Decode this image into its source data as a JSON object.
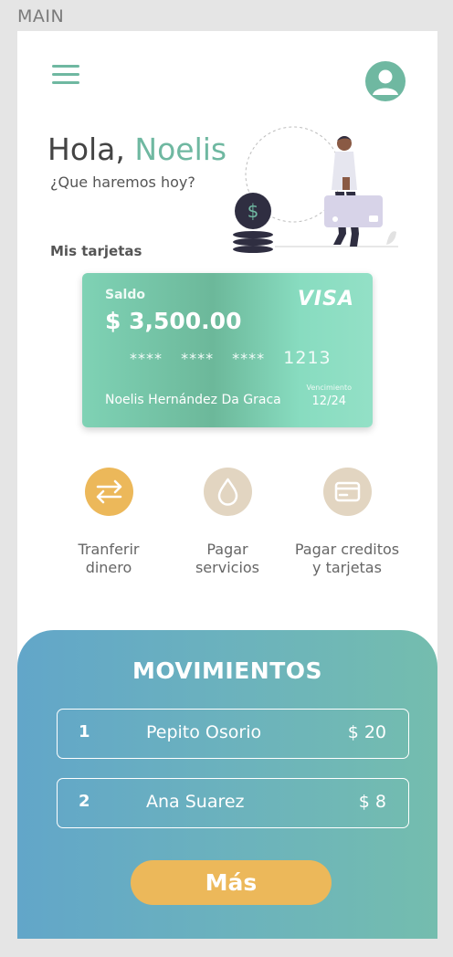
{
  "frame_label": "MAIN",
  "header": {
    "greeting": "Hola,",
    "user_name": "Noelis",
    "subtitle": "¿Que haremos hoy?"
  },
  "cards_section": {
    "title": "Mis tarjetas"
  },
  "card": {
    "balance_label": "Saldo",
    "balance": "$ 3,500.00",
    "brand": "VISA",
    "masked_groups": "**** **** ****",
    "last_digits": "1213",
    "holder": "Noelis Hernández Da Graca",
    "expiry_label": "Vencimiento",
    "expiry": "12/24"
  },
  "actions": [
    {
      "label_line1": "Tranferir",
      "label_line2": "dinero",
      "icon": "transfer-arrows-icon"
    },
    {
      "label_line1": "Pagar",
      "label_line2": "servicios",
      "icon": "water-drop-icon"
    },
    {
      "label_line1": "Pagar creditos",
      "label_line2": "y tarjetas",
      "icon": "credit-card-icon"
    }
  ],
  "movements": {
    "title": "MOVIMIENTOS",
    "rows": [
      {
        "index": "1",
        "name": "Pepito Osorio",
        "amount": "$ 20"
      },
      {
        "index": "2",
        "name": "Ana Suarez",
        "amount": "$ 8"
      }
    ],
    "more_label": "Más"
  },
  "colors": {
    "accent_green": "#6fb8a1",
    "accent_orange": "#ecb85a",
    "beige": "#e2d5c1"
  }
}
